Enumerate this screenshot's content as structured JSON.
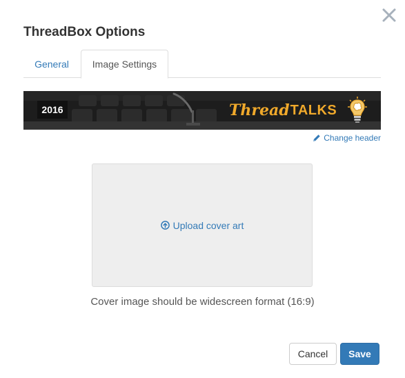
{
  "dialog": {
    "title": "ThreadBox Options"
  },
  "tabs": [
    {
      "label": "General",
      "active": false
    },
    {
      "label": "Image Settings",
      "active": true
    }
  ],
  "header": {
    "year": "2016",
    "brand_thread": "Thread",
    "brand_talks": "TALKS",
    "change_label": "Change header"
  },
  "upload": {
    "label": "Upload cover art",
    "hint": "Cover image should be widescreen format (16:9)"
  },
  "buttons": {
    "cancel": "Cancel",
    "save": "Save"
  },
  "colors": {
    "link": "#337ab7",
    "primary": "#337ab7",
    "brand_accent": "#f0a92b",
    "banner_background": "#1c1c1c",
    "upload_background": "#eeeeee"
  },
  "icons": {
    "close": "close-icon",
    "pencil": "pencil-icon",
    "upload": "upload-circle-icon",
    "lightbulb": "lightbulb-brain-icon",
    "microphone": "microphone-icon"
  }
}
